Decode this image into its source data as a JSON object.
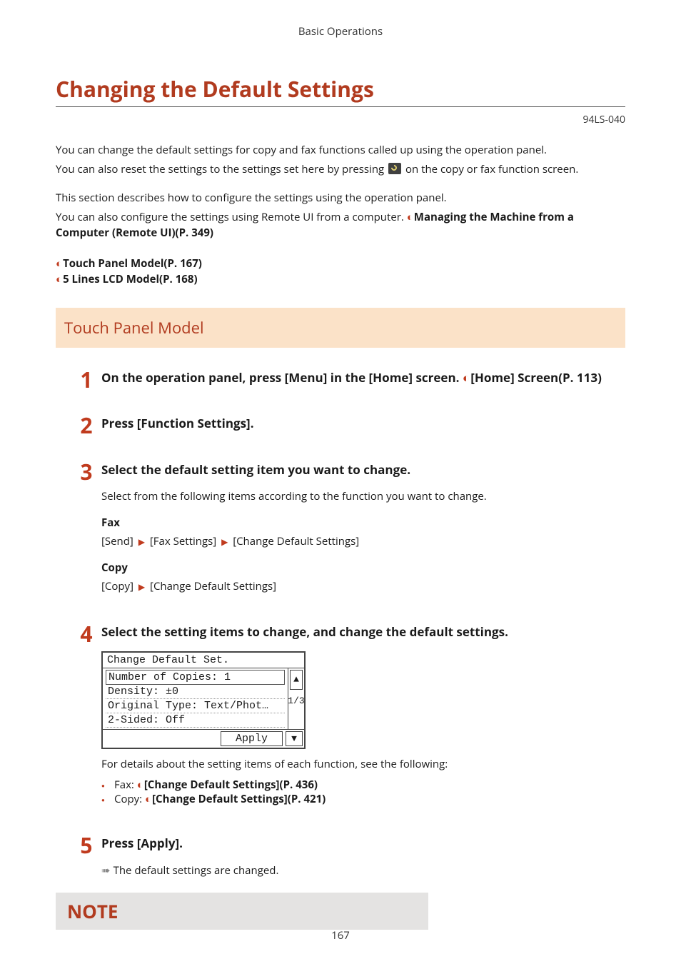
{
  "header_category": "Basic Operations",
  "title": "Changing the Default Settings",
  "doc_id": "94LS-040",
  "intro": {
    "p1": "You can change the default settings for copy and fax functions called up using the operation panel.",
    "p2a": "You can also reset the settings to the settings set here by pressing ",
    "p2b": " on the copy or fax function screen.",
    "p3": "This section describes how to configure the settings using the operation panel.",
    "p4a": "You can also configure the settings using Remote UI from a computer. ",
    "p4link": "Managing the Machine from a Computer (Remote UI)(P. 349)"
  },
  "toc": [
    "Touch Panel Model(P. 167)",
    "5 Lines LCD Model(P. 168)"
  ],
  "section_heading": "Touch Panel Model",
  "steps": {
    "s1": {
      "num": "1",
      "head_a": "On the operation panel, press [Menu] in the [Home] screen. ",
      "head_link": "[Home] Screen(P. 113)"
    },
    "s2": {
      "num": "2",
      "head": "Press [Function Settings]."
    },
    "s3": {
      "num": "3",
      "head": "Select the default setting item you want to change.",
      "lead": "Select from the following items according to the function you want to change.",
      "fax_label": "Fax",
      "fax_path": [
        "[Send]",
        "[Fax Settings]",
        "[Change Default Settings]"
      ],
      "copy_label": "Copy",
      "copy_path": [
        "[Copy]",
        "[Change Default Settings]"
      ]
    },
    "s4": {
      "num": "4",
      "head": "Select the setting items to change, and change the default settings.",
      "details": "For details about the setting items of each function, see the following:",
      "bullets": [
        {
          "pre": "Fax: ",
          "link": "[Change Default Settings](P. 436)"
        },
        {
          "pre": "Copy: ",
          "link": "[Change Default Settings](P. 421)"
        }
      ]
    },
    "s5": {
      "num": "5",
      "head": "Press [Apply].",
      "result": "The default settings are changed."
    }
  },
  "panel": {
    "title": "Change Default Set.",
    "rows": [
      "Number of Copies: 1",
      "Density: ±0",
      "Original Type: Text/Phot…",
      "2-Sided: Off"
    ],
    "page_ind": "1/3",
    "apply": "Apply",
    "up": "▲",
    "down": "▼"
  },
  "note_label": "NOTE",
  "page_number": "167"
}
